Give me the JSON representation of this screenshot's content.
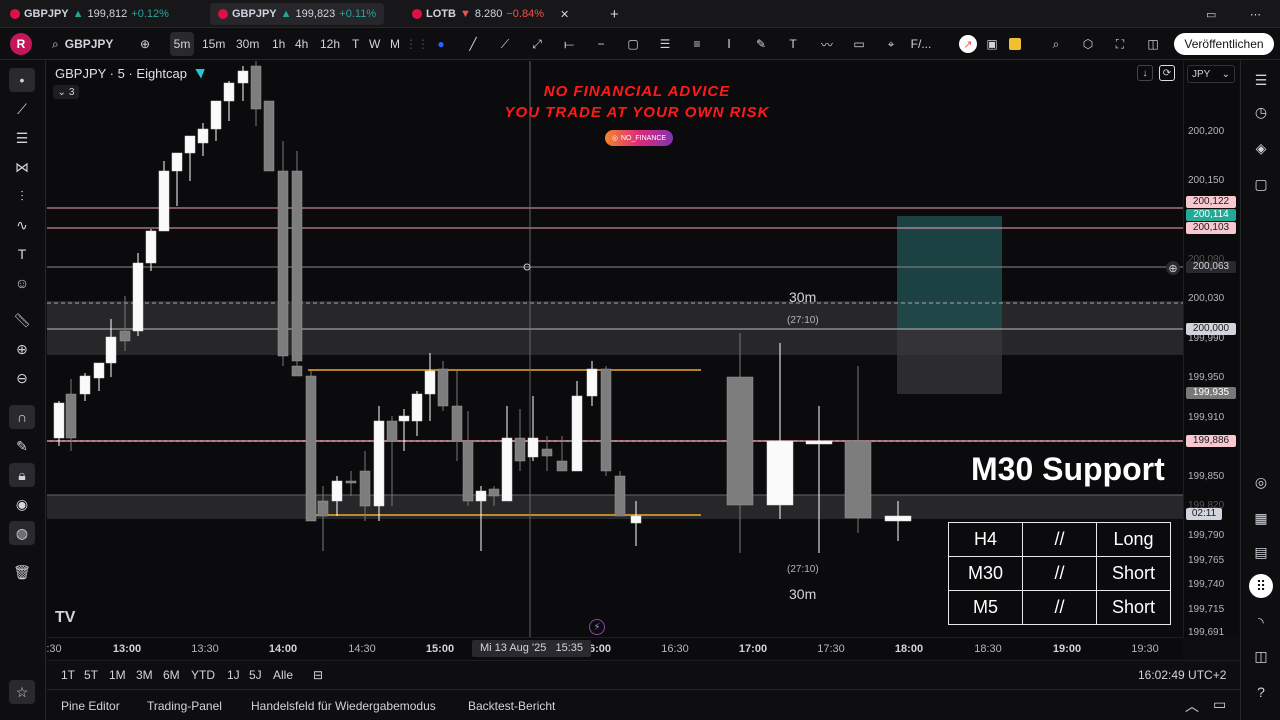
{
  "tabs": [
    {
      "symbol": "GBPJPY",
      "arrow": "▲",
      "price": "199,812",
      "change": "+0.12%",
      "dir": "up"
    },
    {
      "symbol": "GBPJPY",
      "arrow": "▲",
      "price": "199,823",
      "change": "+0.11%",
      "dir": "up"
    },
    {
      "symbol": "LOTB",
      "arrow": "▼",
      "price": "8.280",
      "change": "−0.84%",
      "dir": "down"
    }
  ],
  "toolbar": {
    "avatar": "R",
    "symbol": "GBPJPY",
    "intervals": [
      "5m",
      "15m",
      "30m",
      "1h",
      "4h",
      "12h",
      "T",
      "W",
      "M"
    ],
    "active_interval": "5m",
    "text_tool": "F/...",
    "publish": "Veröffentlichen"
  },
  "legend": {
    "title": "GBPJPY · 5 · Eightcap",
    "collapse_count": "3"
  },
  "banner": {
    "line1": "NO FINANCIAL ADVICE",
    "line2": "YOU TRADE AT YOUR OWN RISK",
    "handle": "NO_FINANCE"
  },
  "annotations": {
    "m30_support": "M30 Support",
    "top_tf": "30m",
    "top_countdown": "(27:10)",
    "bottom_countdown": "(27:10)",
    "bottom_tf": "30m"
  },
  "signal_table": [
    [
      "H4",
      "//",
      "Long"
    ],
    [
      "M30",
      "//",
      "Short"
    ],
    [
      "M5",
      "//",
      "Short"
    ]
  ],
  "price_axis": {
    "currency": "JPY",
    "labels": [
      "200,200",
      "200,150",
      "200,090",
      "200,030",
      "199,990",
      "199,950",
      "199,910",
      "199,850",
      "199,820",
      "199,790",
      "199,765",
      "199,740",
      "199,715",
      "199,691"
    ],
    "tags": [
      {
        "v": "200,122",
        "bg": "#f8c8d0",
        "fg": "#1a1a1a"
      },
      {
        "v": "200,114",
        "bg": "#22ab94",
        "fg": "#ffffff"
      },
      {
        "v": "200,103",
        "bg": "#f8c8d0",
        "fg": "#1a1a1a"
      },
      {
        "v": "200,063",
        "bg": "#2a2a2e",
        "fg": "#d1d4dc"
      },
      {
        "v": "200,000",
        "bg": "#d1d4dc",
        "fg": "#1a1a1a"
      },
      {
        "v": "199,935",
        "bg": "#777777",
        "fg": "#ffffff"
      },
      {
        "v": "199,886",
        "bg": "#f8c8d0",
        "fg": "#1a1a1a"
      },
      {
        "v": "02:11",
        "bg": "#d1d4dc",
        "fg": "#1a1a1a"
      }
    ]
  },
  "time_axis": {
    "labels": [
      {
        "t": ":30"
      },
      {
        "t": "13:00",
        "b": true
      },
      {
        "t": "13:30"
      },
      {
        "t": "14:00",
        "b": true
      },
      {
        "t": "14:30"
      },
      {
        "t": "15:00",
        "b": true
      },
      {
        "t": "6:00",
        "b": true
      },
      {
        "t": "16:30"
      },
      {
        "t": "17:00",
        "b": true
      },
      {
        "t": "17:30"
      },
      {
        "t": "18:00",
        "b": true
      },
      {
        "t": "18:30"
      },
      {
        "t": "19:00",
        "b": true
      },
      {
        "t": "19:30"
      }
    ],
    "crosshair": "Mi 13 Aug '25   15:35"
  },
  "ranges": [
    "1T",
    "5T",
    "1M",
    "3M",
    "6M",
    "YTD",
    "1J",
    "5J",
    "Alle"
  ],
  "clock": "16:02:49 UTC+2",
  "bottom_tabs": [
    "Pine Editor",
    "Trading-Panel",
    "Handelsfeld für Wiedergabemodus",
    "Backtest-Bericht"
  ],
  "colors": {
    "bull": "#ffffff",
    "bear": "#787878",
    "support_line": "#f2a6b3",
    "orange_box": "#f0a830",
    "zone": "#2a2a2d",
    "target_zone": "#1f4f50"
  }
}
